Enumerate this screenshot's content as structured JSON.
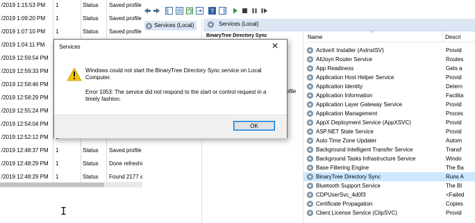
{
  "log": {
    "rows": [
      {
        "time": "/2019 1:15:53 PM",
        "num": "1",
        "type": "Status",
        "msg": "Saved profile"
      },
      {
        "time": "/2019 1:09:20 PM",
        "num": "1",
        "type": "Status",
        "msg": "Saved profile"
      },
      {
        "time": "/2019 1:07:10 PM",
        "num": "1",
        "type": "Status",
        "msg": "Saved profile"
      },
      {
        "time": "/2019 1:04:11 PM",
        "num": "1",
        "type": "",
        "msg": ""
      },
      {
        "time": "/2019 12:59:54 PM",
        "num": "1",
        "type": "",
        "msg": ""
      },
      {
        "time": "/2019 12:59:33 PM",
        "num": "1",
        "type": "",
        "msg": ""
      },
      {
        "time": "/2019 12:58:46 PM",
        "num": "1",
        "type": "",
        "msg": ""
      },
      {
        "time": "/2019 12:58:29 PM",
        "num": "1",
        "type": "",
        "msg": ""
      },
      {
        "time": "/2019 12:55:24 PM",
        "num": "1",
        "type": "",
        "msg": ""
      },
      {
        "time": "/2019 12:54:04 PM",
        "num": "1",
        "type": "",
        "msg": ""
      },
      {
        "time": "/2019 12:52:12 PM",
        "num": "1",
        "type": "",
        "msg": ""
      },
      {
        "time": "/2019 12:48:37 PM",
        "num": "1",
        "type": "Status",
        "msg": "Saved profile"
      },
      {
        "time": "/2019 12:48:29 PM",
        "num": "1",
        "type": "Status",
        "msg": "Done refreshi"
      },
      {
        "time": "/2019 12:48:29 PM",
        "num": "1",
        "type": "Status",
        "msg": "Found 2177 a"
      }
    ]
  },
  "tree": {
    "item_label": "Services (Local)"
  },
  "services": {
    "pane_title": "Services (Local)",
    "detail_title": "BinaryTree Directory Sync",
    "detail_fragment": "rofile",
    "columns": {
      "name": "Name",
      "description": "Descri"
    },
    "rows": [
      {
        "name": "ActiveX Installer (AxInstSV)",
        "desc": "Provid"
      },
      {
        "name": "AllJoyn Router Service",
        "desc": "Routes"
      },
      {
        "name": "App Readiness",
        "desc": "Gets a"
      },
      {
        "name": "Application Host Helper Service",
        "desc": "Provid"
      },
      {
        "name": "Application Identity",
        "desc": "Detern"
      },
      {
        "name": "Application Information",
        "desc": "Facilita"
      },
      {
        "name": "Application Layer Gateway Service",
        "desc": "Provid"
      },
      {
        "name": "Application Management",
        "desc": "Proces"
      },
      {
        "name": "AppX Deployment Service (AppXSVC)",
        "desc": "Provid"
      },
      {
        "name": "ASP.NET State Service",
        "desc": "Provid"
      },
      {
        "name": "Auto Time Zone Updater",
        "desc": "Autom"
      },
      {
        "name": "Background Intelligent Transfer Service",
        "desc": "Transf"
      },
      {
        "name": "Background Tasks Infrastructure Service",
        "desc": "Windo"
      },
      {
        "name": "Base Filtering Engine",
        "desc": "The Ba"
      },
      {
        "name": "BinaryTree Directory Sync",
        "desc": "Runs A",
        "selected": true
      },
      {
        "name": "Bluetooth Support Service",
        "desc": "The Bl"
      },
      {
        "name": "CDPUserSvc_4d0f3",
        "desc": "<Failed"
      },
      {
        "name": "Certificate Propagation",
        "desc": "Copies"
      },
      {
        "name": "Client License Service (ClipSVC)",
        "desc": "Provid"
      }
    ]
  },
  "dialog": {
    "title": "Services",
    "close": "✕",
    "message1": "Windows could not start the BinaryTree Directory Sync service on Local Computer.",
    "message2": "Error 1053: The service did not respond to the start or control request in a timely fashion.",
    "ok_label": "OK"
  },
  "cursor": "I",
  "colors": {
    "selection": "#cce8ff",
    "pane_header": "#dbe5f3",
    "ok_border": "#0078d7",
    "warning": "#f4c400"
  },
  "icons": [
    "back-icon",
    "forward-icon",
    "console-tree-icon",
    "properties-icon",
    "refresh-icon",
    "export-icon",
    "help-icon",
    "action-pane-icon",
    "start-icon",
    "stop-icon",
    "pause-icon",
    "restart-icon",
    "service-gear-icon",
    "warning-icon",
    "close-icon"
  ]
}
